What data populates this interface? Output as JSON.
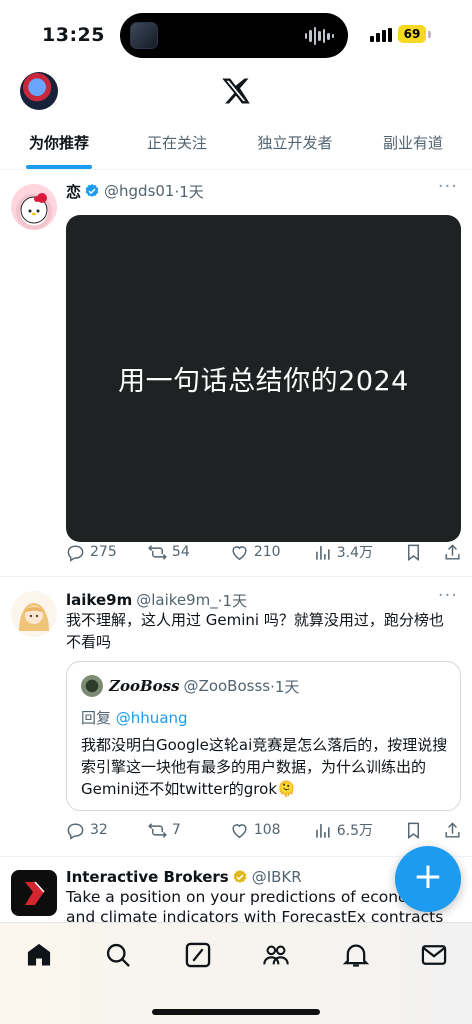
{
  "status_bar": {
    "time": "13:25",
    "battery": "69"
  },
  "header": {
    "logo": "x-logo-icon"
  },
  "tabs": [
    {
      "label": "为你推荐",
      "active": true
    },
    {
      "label": "正在关注",
      "active": false
    },
    {
      "label": "独立开发者",
      "active": false
    },
    {
      "label": "副业有道",
      "active": false
    }
  ],
  "posts": [
    {
      "name": "恋",
      "handle": "@hgds01",
      "time": "·1天",
      "verified": true,
      "image_text": "用一句话总结你的2024",
      "replies": "275",
      "reposts": "54",
      "likes": "210",
      "views": "3.4万"
    },
    {
      "name": "laike9m",
      "handle": "@laike9m_",
      "time": "·1天",
      "text": "我不理解，这人用过 Gemini 吗？就算没用过，跑分榜也不看吗",
      "quote": {
        "name": "ZooBoss",
        "handle": "@ZooBosss",
        "time": "·1天",
        "reply_prefix": "回复",
        "reply_to": "@hhuang",
        "text": "我都没明白Google这轮ai竞赛是怎么落后的，按理说搜索引擎这一块他有最多的用户数据，为什么训练出的Gemini还不如twitter的grok🫠"
      },
      "replies": "32",
      "reposts": "7",
      "likes": "108",
      "views": "6.5万"
    },
    {
      "name": "Interactive Brokers",
      "handle": "@IBKR",
      "verified": true,
      "text": "Take a position on your predictions of economic and climate indicators with ForecastEx contracts at IBKR!"
    }
  ],
  "more_menu": "···",
  "fab_label": "+",
  "colors": {
    "accent": "#1d9bf0",
    "gold_verified": "#e2b719"
  }
}
